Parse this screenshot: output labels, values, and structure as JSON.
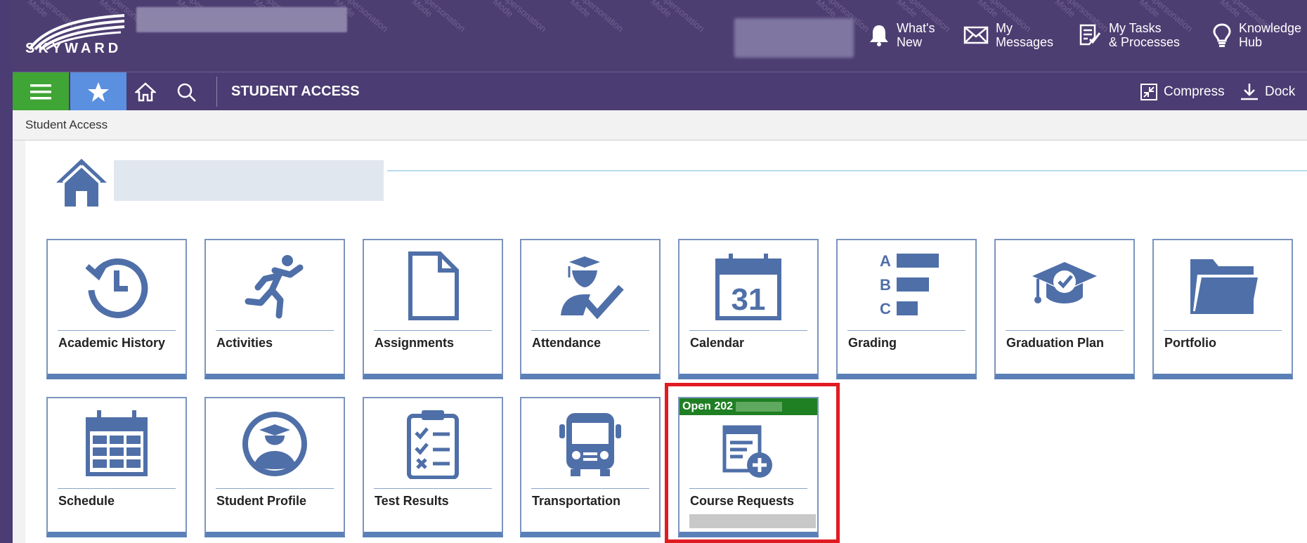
{
  "brand": {
    "logo_text": "SKYWARD"
  },
  "topbar": {
    "watermark": "Impersonation\nMode",
    "items": [
      {
        "label": "What's\nNew",
        "icon": "bell-icon"
      },
      {
        "label": "My\nMessages",
        "icon": "envelope-icon"
      },
      {
        "label": "My Tasks\n& Processes",
        "icon": "tasks-icon"
      },
      {
        "label": "Knowledge\nHub",
        "icon": "lightbulb-icon"
      }
    ]
  },
  "navbar": {
    "title": "STUDENT ACCESS",
    "compress_label": "Compress",
    "dock_label": "Dock"
  },
  "breadcrumb": "Student Access",
  "tiles_row1": [
    {
      "label": "Academic History",
      "icon": "history-icon"
    },
    {
      "label": "Activities",
      "icon": "running-person-icon"
    },
    {
      "label": "Assignments",
      "icon": "document-icon"
    },
    {
      "label": "Attendance",
      "icon": "graduate-check-icon"
    },
    {
      "label": "Calendar",
      "icon": "calendar-31-icon",
      "day": "31"
    },
    {
      "label": "Grading",
      "icon": "abc-bars-icon",
      "letters": [
        "A",
        "B",
        "C"
      ]
    },
    {
      "label": "Graduation Plan",
      "icon": "graduation-cap-check-icon"
    },
    {
      "label": "Portfolio",
      "icon": "folder-icon"
    }
  ],
  "tiles_row2": [
    {
      "label": "Schedule",
      "icon": "schedule-calendar-icon"
    },
    {
      "label": "Student Profile",
      "icon": "student-avatar-icon"
    },
    {
      "label": "Test Results",
      "icon": "checklist-icon"
    },
    {
      "label": "Transportation",
      "icon": "bus-icon"
    },
    {
      "label": "Course Requests",
      "icon": "add-document-icon",
      "badge": "Open 202"
    }
  ],
  "colors": {
    "topbar": "#4d3e72",
    "menu_green": "#3fa534",
    "star_blue": "#5b8fe0",
    "tile_icon": "#4f6fa8",
    "highlight_red": "#e11b22",
    "badge_green": "#1f7f23"
  }
}
